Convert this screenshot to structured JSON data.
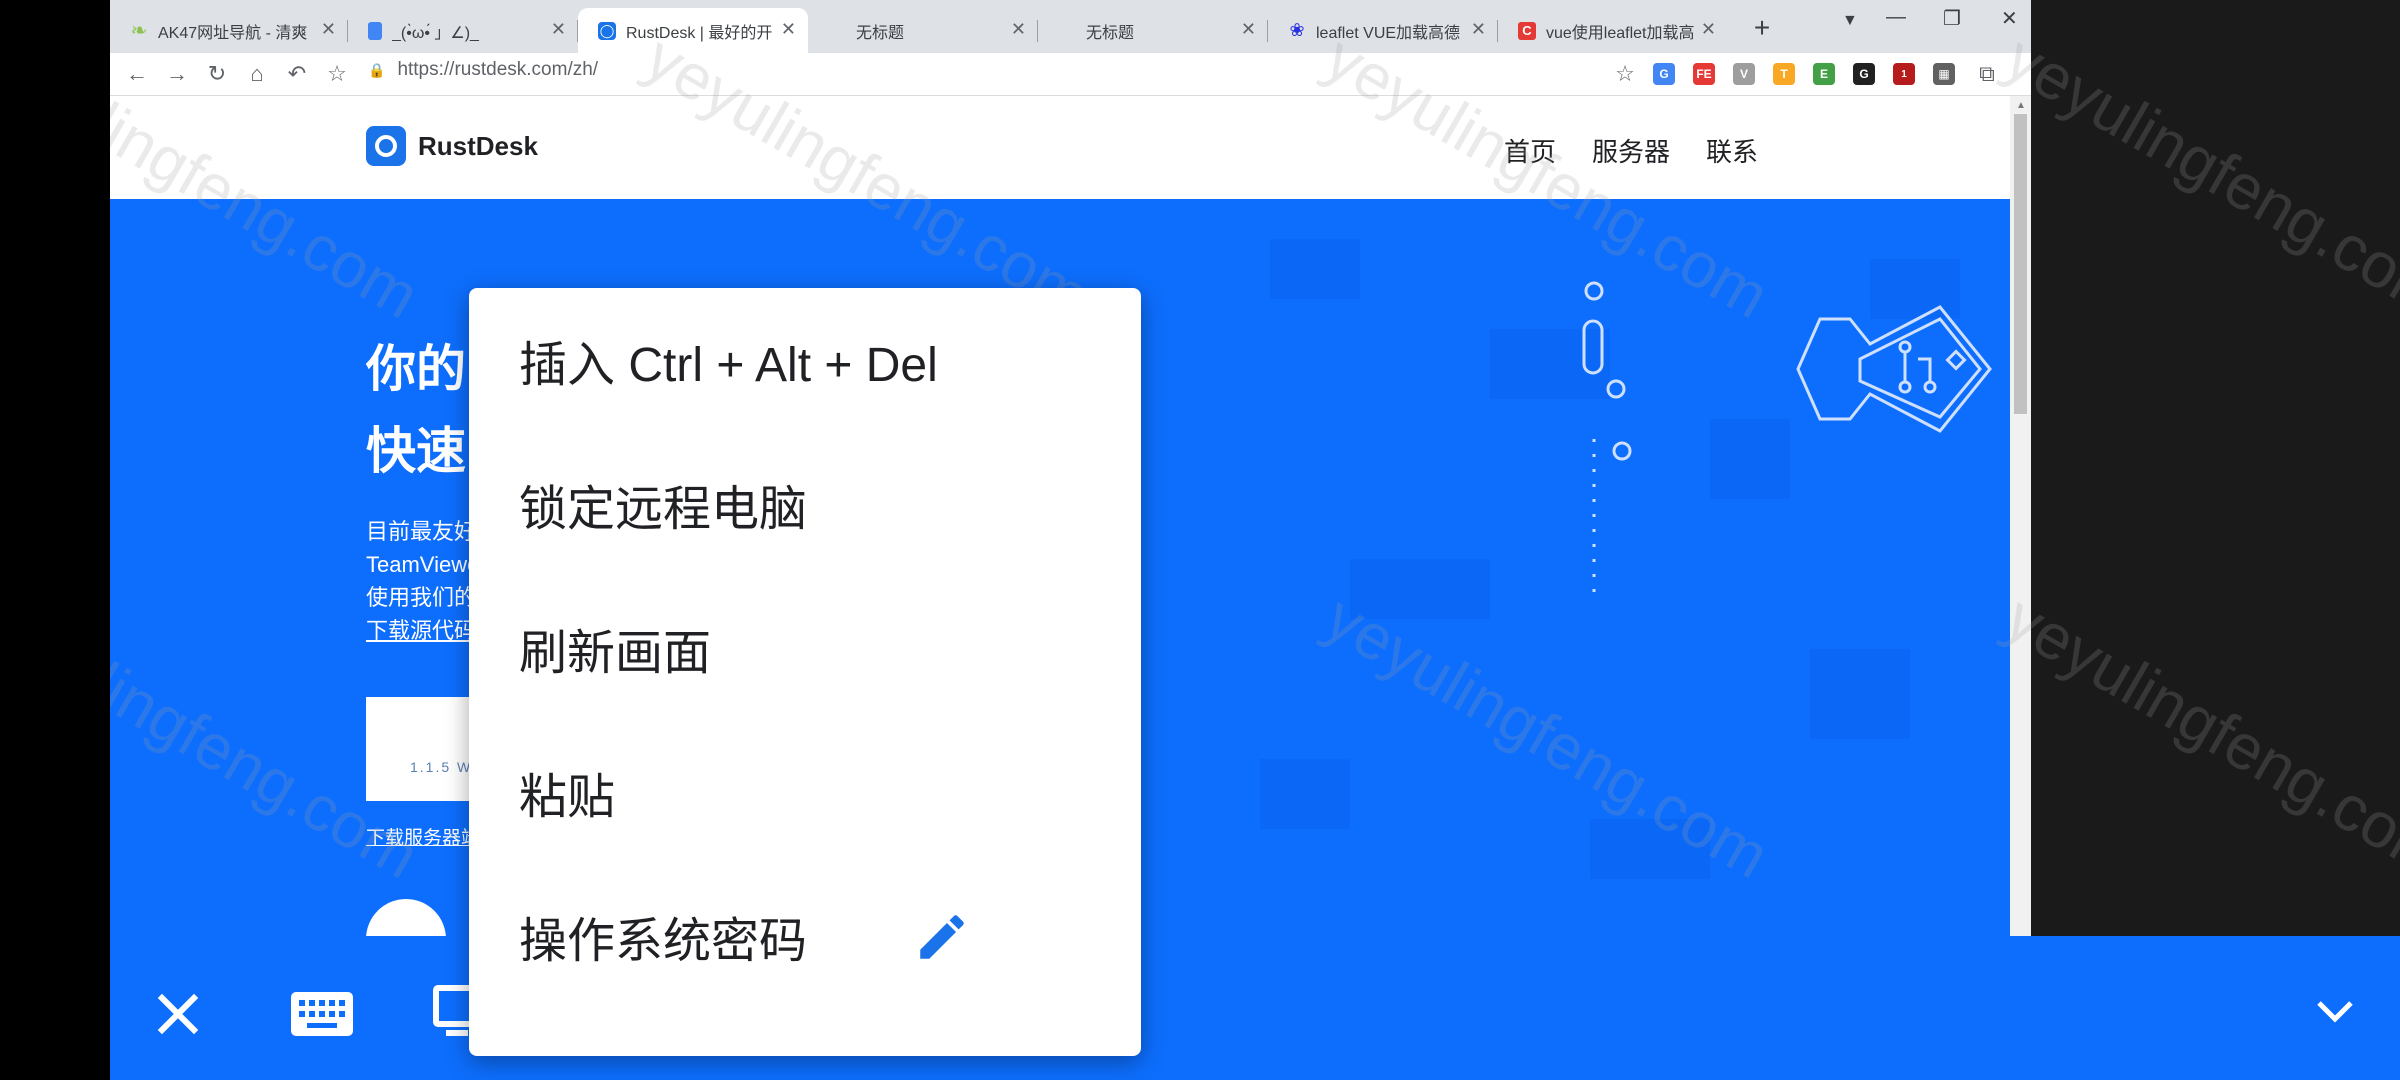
{
  "browser": {
    "tabs": [
      {
        "title": "AK47网址导航 - 清爽",
        "favicon": "leaf-icon",
        "color": "#8bc34a"
      },
      {
        "title": "_(•̀ω•́ 」∠)_",
        "favicon": "doc-icon",
        "color": "#4285f4"
      },
      {
        "title": "RustDesk | 最好的开",
        "favicon": "rustdesk-icon",
        "color": "#1a73e8",
        "active": true
      },
      {
        "title": "无标题",
        "favicon": "",
        "color": ""
      },
      {
        "title": "无标题",
        "favicon": "",
        "color": ""
      },
      {
        "title": "leaflet VUE加载高德",
        "favicon": "paw-icon",
        "color": "#2932e1"
      },
      {
        "title": "vue使用leaflet加载高",
        "favicon": "c-icon",
        "color": "#e53935"
      }
    ],
    "url": "https://rustdesk.com/zh/",
    "extension_badge": "1"
  },
  "site": {
    "brand": "RustDesk",
    "nav": [
      "首页",
      "服务器",
      "联系"
    ],
    "hero_title_1": "你的",
    "hero_title_2": "快速",
    "hero_text": [
      "目前最友好",
      "TeamViewe",
      "使用我们的",
      "下载源代码"
    ],
    "download_version": "1.1.5 W",
    "download_server": "下载服务器端"
  },
  "menu": {
    "items": [
      "插入 Ctrl + Alt + Del",
      "锁定远程电脑",
      "刷新画面",
      "粘贴",
      "操作系统密码"
    ]
  },
  "watermark": "yeyulingfeng.com",
  "colors": {
    "brand_blue": "#0d6efd",
    "tab_strip": "#dee1e6"
  }
}
